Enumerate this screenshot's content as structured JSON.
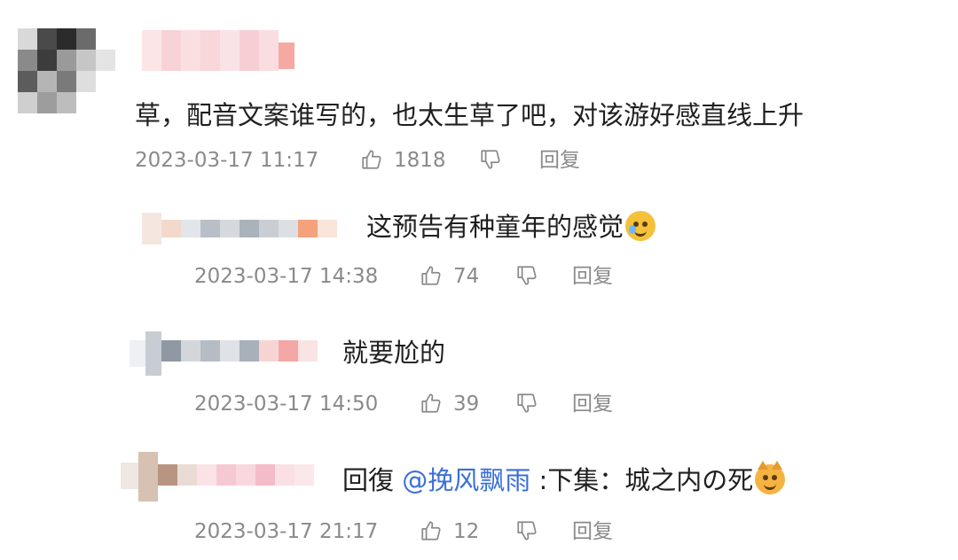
{
  "comments": [
    {
      "text": "草，配音文案谁写的，也太生草了吧，对该游好感直线上升",
      "timestamp": "2023-03-17 11:17",
      "likes": "1818",
      "reply_label": "回复"
    },
    {
      "text": "这预告有种童年的感觉",
      "emoji": "crying-face-emoji",
      "timestamp": "2023-03-17 14:38",
      "likes": "74",
      "reply_label": "回复"
    },
    {
      "text": "就要尬的",
      "timestamp": "2023-03-17 14:50",
      "likes": "39",
      "reply_label": "回复"
    },
    {
      "reply_prefix": "回復 ",
      "mention": "@挽风飘雨",
      "text": " :下集：城之内の死",
      "emoji": "dog-face-emoji",
      "timestamp": "2023-03-17 21:17",
      "likes": "12",
      "reply_label": "回复"
    }
  ],
  "colors": {
    "text": "#1f1f1f",
    "meta": "#8a8a8a",
    "mention": "#3a6fd8"
  }
}
